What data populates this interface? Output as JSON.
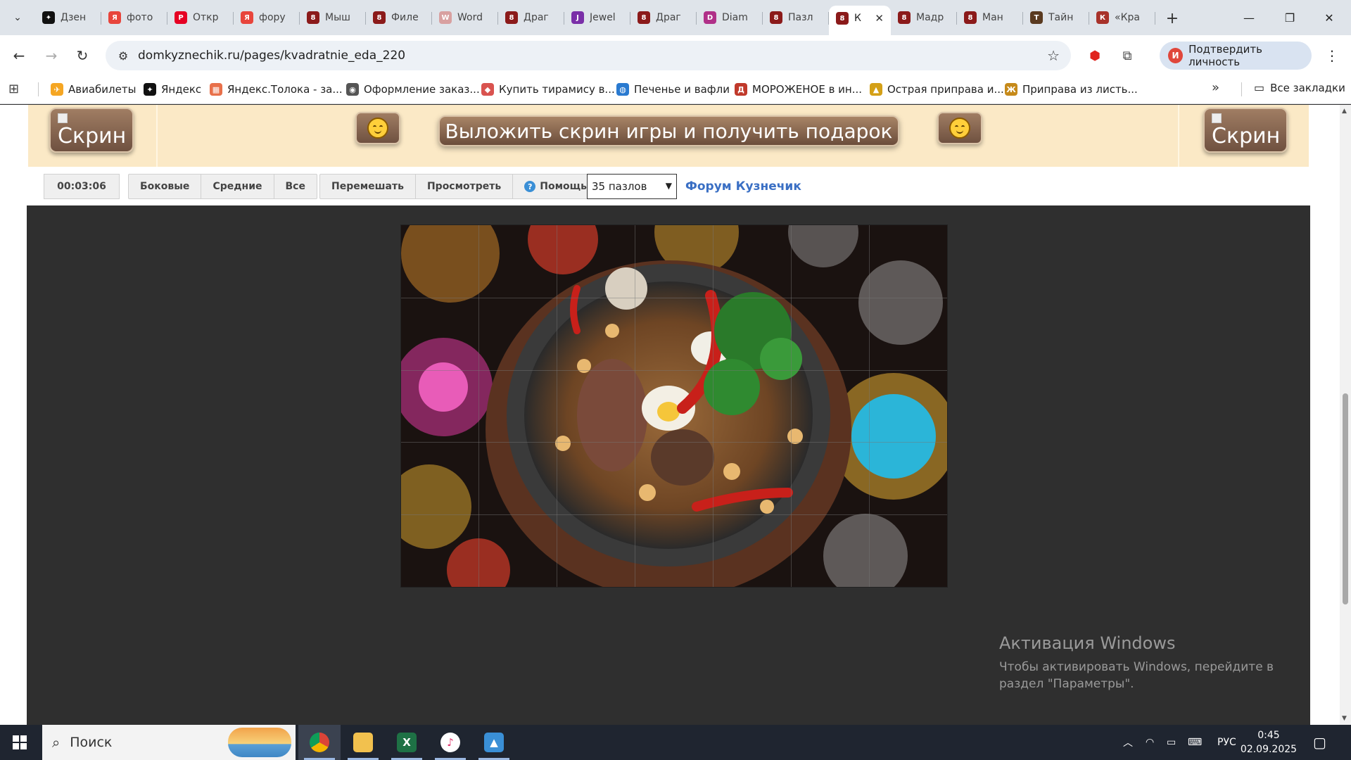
{
  "tabs": [
    {
      "title": "Дзен",
      "fav_color": "#111111",
      "fav_glyph": "✦"
    },
    {
      "title": "фото",
      "fav_color": "#e8453c",
      "fav_glyph": "Я"
    },
    {
      "title": "Откр",
      "fav_color": "#e60023",
      "fav_glyph": "P"
    },
    {
      "title": "фору",
      "fav_color": "#e8453c",
      "fav_glyph": "Я"
    },
    {
      "title": "Мыш",
      "fav_color": "#8b1a1a",
      "fav_glyph": "8"
    },
    {
      "title": "Филе",
      "fav_color": "#8b1a1a",
      "fav_glyph": "8"
    },
    {
      "title": "Word",
      "fav_color": "#d8a0a0",
      "fav_glyph": "W"
    },
    {
      "title": "Драг",
      "fav_color": "#8b1a1a",
      "fav_glyph": "8"
    },
    {
      "title": "Jewel",
      "fav_color": "#7a2fa8",
      "fav_glyph": "J"
    },
    {
      "title": "Драг",
      "fav_color": "#8b1a1a",
      "fav_glyph": "8"
    },
    {
      "title": "Diam",
      "fav_color": "#b03088",
      "fav_glyph": "D"
    },
    {
      "title": "Пазл",
      "fav_color": "#8b1a1a",
      "fav_glyph": "8"
    },
    {
      "title": "К",
      "fav_color": "#8b1a1a",
      "fav_glyph": "8",
      "active": true
    },
    {
      "title": "Мадр",
      "fav_color": "#8b1a1a",
      "fav_glyph": "8"
    },
    {
      "title": "Ман",
      "fav_color": "#8b1a1a",
      "fav_glyph": "8"
    },
    {
      "title": "Тайн",
      "fav_color": "#5a3a20",
      "fav_glyph": "T"
    },
    {
      "title": "«Кра",
      "fav_color": "#a8322a",
      "fav_glyph": "К"
    }
  ],
  "address": {
    "url": "domkyznechik.ru/pages/kvadratnie_eda_220"
  },
  "profile": {
    "label": "Подтвердить личность",
    "initial": "И"
  },
  "bookmarks": [
    {
      "label": "Авиабилеты",
      "ico_color": "#f5a623",
      "glyph": "✈"
    },
    {
      "label": "Яндекс",
      "ico_color": "#111111",
      "glyph": "✦"
    },
    {
      "label": "Яндекс.Толока - за...",
      "ico_color": "#e8704a",
      "glyph": "▦"
    },
    {
      "label": "Оформление заказ...",
      "ico_color": "#555555",
      "glyph": "◉"
    },
    {
      "label": "Купить тирамису в...",
      "ico_color": "#d9534f",
      "glyph": "◆"
    },
    {
      "label": "Печенье и вафли",
      "ico_color": "#2a7ad0",
      "glyph": "◍"
    },
    {
      "label": "МОРОЖЕНОЕ в ин...",
      "ico_color": "#c0392b",
      "glyph": "Д"
    },
    {
      "label": "Острая приправа и...",
      "ico_color": "#d4a017",
      "glyph": "▲"
    },
    {
      "label": "Приправа из листь...",
      "ico_color": "#c68a1a",
      "glyph": "Ж"
    }
  ],
  "all_bookmarks": "Все закладки",
  "banner": {
    "skrin_left": "Скрин",
    "skrin_right": "Скрин",
    "post_label": "Выложить скрин игры и получить подарок"
  },
  "controls": {
    "timer": "00:03:06",
    "group1": [
      "Боковые",
      "Средние",
      "Все"
    ],
    "shuffle": "Перемешать",
    "preview": "Просмотреть",
    "help": "Помощь",
    "pieces_select": "35 пазлов",
    "forum_link": "Форум Кузнечик"
  },
  "activation": {
    "title": "Активация Windows",
    "text": "Чтобы активировать Windows, перейдите в раздел \"Параметры\"."
  },
  "taskbar": {
    "search_placeholder": "Поиск",
    "lang": "РУС",
    "time": "0:45",
    "date": "02.09.2025"
  }
}
